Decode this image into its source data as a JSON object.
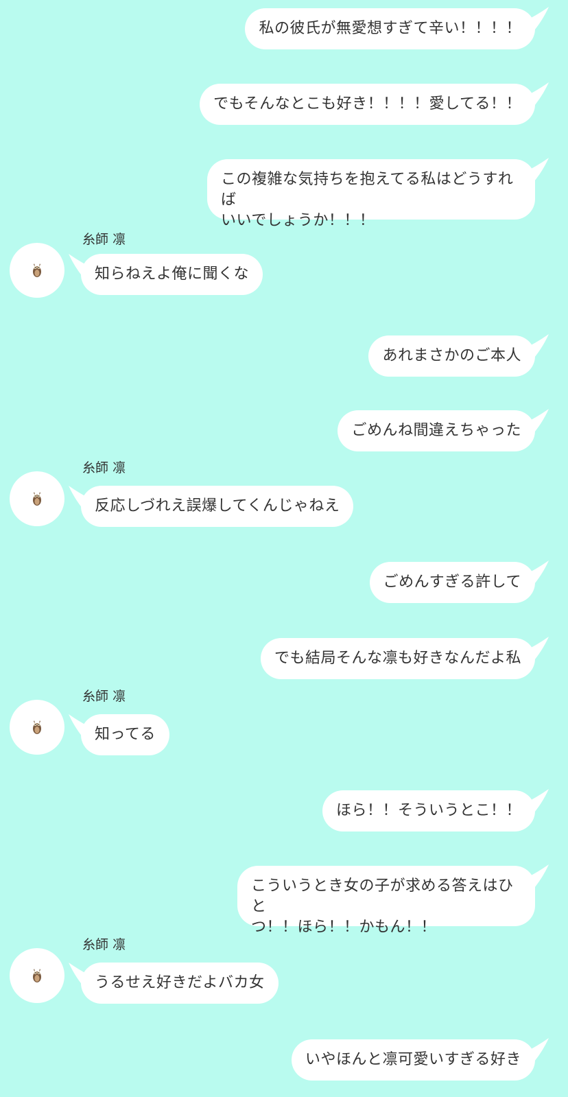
{
  "colors": {
    "background": "#b9fbef",
    "bubble": "#ffffff",
    "text": "#333333"
  },
  "contact": {
    "name": "糸師 凛",
    "avatar_icon": "owl-icon"
  },
  "messages": [
    {
      "side": "out",
      "text": "私の彼氏が無愛想すぎて辛い！！！！"
    },
    {
      "side": "out",
      "text": "でもそんなとこも好き！！！！愛してる！！"
    },
    {
      "side": "out",
      "text": "この複雑な気持ちを抱えてる私はどうすれば\nいいでしょうか！！！"
    },
    {
      "side": "in",
      "name": "糸師 凛",
      "text": "知らねえよ俺に聞くな"
    },
    {
      "side": "out",
      "text": "あれまさかのご本人"
    },
    {
      "side": "out",
      "text": "ごめんね間違えちゃった"
    },
    {
      "side": "in",
      "name": "糸師 凛",
      "text": "反応しづれえ誤爆してくんじゃねえ"
    },
    {
      "side": "out",
      "text": "ごめんすぎる許して"
    },
    {
      "side": "out",
      "text": "でも結局そんな凛も好きなんだよ私"
    },
    {
      "side": "in",
      "name": "糸師 凛",
      "text": "知ってる"
    },
    {
      "side": "out",
      "text": "ほら！！そういうとこ！！"
    },
    {
      "side": "out",
      "text": "こういうとき女の子が求める答えはひと\nつ！！ほら！！かもん！！"
    },
    {
      "side": "in",
      "name": "糸師 凛",
      "text": "うるせえ好きだよバカ女"
    },
    {
      "side": "out",
      "text": "いやほんと凛可愛いすぎる好き"
    }
  ]
}
